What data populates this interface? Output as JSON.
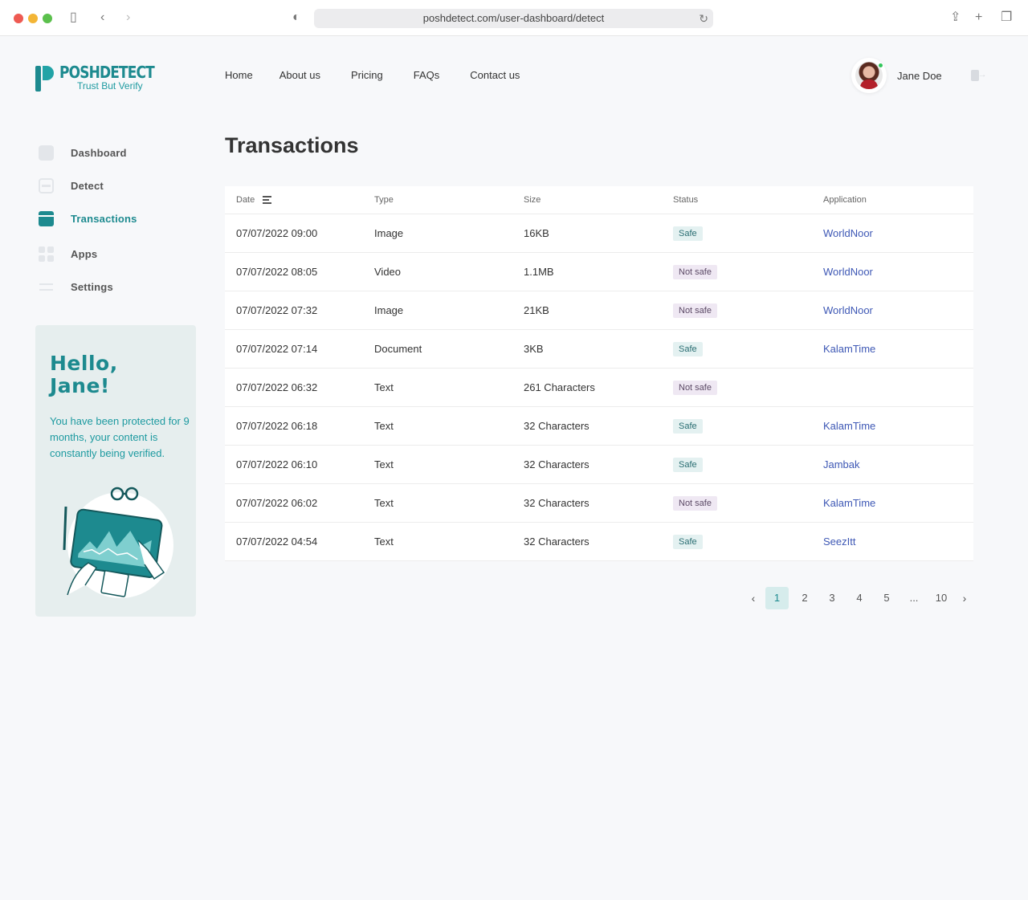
{
  "browser": {
    "url": "poshdetect.com/user-dashboard/detect"
  },
  "brand": {
    "name": "POSHDETECT",
    "tagline": "Trust But Verify",
    "color": "#1d8a8f"
  },
  "nav": {
    "items": [
      "Home",
      "About us",
      "Pricing",
      "FAQs",
      "Contact us"
    ]
  },
  "user": {
    "name": "Jane Doe",
    "online": true
  },
  "sidebar": {
    "items": [
      {
        "label": "Dashboard",
        "icon": "dashboard-icon",
        "active": false
      },
      {
        "label": "Detect",
        "icon": "detect-icon",
        "active": false
      },
      {
        "label": "Transactions",
        "icon": "transactions-icon",
        "active": true
      },
      {
        "label": "Apps",
        "icon": "apps-icon",
        "active": false
      },
      {
        "label": "Settings",
        "icon": "settings-icon",
        "active": false
      }
    ]
  },
  "hello_card": {
    "title_line1": "Hello,",
    "title_line2": "Jane!",
    "text": "You have been protected for 9 months, your content is constantly being verified."
  },
  "main": {
    "title": "Transactions",
    "columns": [
      "Date",
      "Type",
      "Size",
      "Status",
      "Application"
    ],
    "rows": [
      {
        "date": "07/07/2022 09:00",
        "type": "Image",
        "size": "16KB",
        "status": "Safe",
        "application": "WorldNoor"
      },
      {
        "date": "07/07/2022 08:05",
        "type": "Video",
        "size": "1.1MB",
        "status": "Not safe",
        "application": "WorldNoor"
      },
      {
        "date": "07/07/2022 07:32",
        "type": "Image",
        "size": "21KB",
        "status": "Not safe",
        "application": "WorldNoor"
      },
      {
        "date": "07/07/2022 07:14",
        "type": "Document",
        "size": "3KB",
        "status": "Safe",
        "application": "KalamTime"
      },
      {
        "date": "07/07/2022 06:32",
        "type": "Text",
        "size": "261 Characters",
        "status": "Not safe",
        "application": ""
      },
      {
        "date": "07/07/2022 06:18",
        "type": "Text",
        "size": "32 Characters",
        "status": "Safe",
        "application": "KalamTime"
      },
      {
        "date": "07/07/2022 06:10",
        "type": "Text",
        "size": "32 Characters",
        "status": "Safe",
        "application": "Jambak"
      },
      {
        "date": "07/07/2022 06:02",
        "type": "Text",
        "size": "32 Characters",
        "status": "Not safe",
        "application": "KalamTime"
      },
      {
        "date": "07/07/2022 04:54",
        "type": "Text",
        "size": "32 Characters",
        "status": "Safe",
        "application": "SeezItt"
      }
    ]
  },
  "pagination": {
    "prev": "‹",
    "next": "›",
    "pages": [
      "1",
      "2",
      "3",
      "4",
      "5",
      "...",
      "10"
    ],
    "current": "1"
  }
}
